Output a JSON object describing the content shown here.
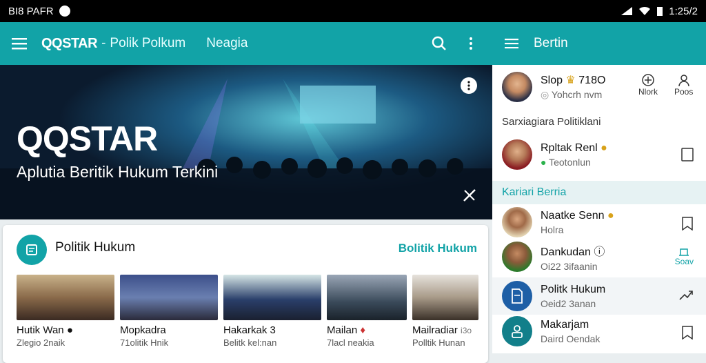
{
  "status": {
    "left": "BI8 PAFR",
    "time": "1:25/2",
    "icons": [
      "wifi-icon",
      "signal-icon",
      "battery-icon"
    ]
  },
  "appbar": {
    "title": "QQSTAR",
    "separator": "-",
    "subtitle": "Polik Polkum",
    "media": "Neagia"
  },
  "hero": {
    "heading": "QQSTAR",
    "tagline": "Aplutia Beritik Hukum Terkini"
  },
  "card": {
    "title": "Politik Hukum",
    "link": "Bolitik Hukum",
    "items": [
      {
        "title": "Hutik Wan",
        "sub": "Zlegio 2naik"
      },
      {
        "title": "Mopkadra",
        "sub": "71olitik Hnik"
      },
      {
        "title": "Hakarkak 3",
        "sub": "Belitk kel:nan"
      },
      {
        "title": "Mailan",
        "sub": "7lacl neakia"
      },
      {
        "title": "Mailradiar",
        "sub": "Polltik Hunan",
        "extra": "i3o"
      }
    ]
  },
  "panel": {
    "title": "Bertin",
    "profile": {
      "name": "Slop",
      "extra": "718O",
      "sub": "Yohcrh nvm",
      "action1": "Nlork",
      "action2": "Poos"
    },
    "section1": "Sarxiagiara Politiklani",
    "item1": {
      "name": "Rpltak Renl",
      "sub": "Teotonlun"
    },
    "section2": "Kariari Berria",
    "list": [
      {
        "name": "Naatke Senn",
        "sub": "Holra"
      },
      {
        "name": "Dankudan",
        "sub": "Oi22 3ifaanin",
        "action": "Soav"
      },
      {
        "name": "Politk Hukum",
        "sub": "Oeid2 3anan"
      },
      {
        "name": "Makarjam",
        "sub": "Daird Oendak"
      }
    ]
  },
  "colors": {
    "accent": "#12a3a7",
    "statusbar": "#000000"
  }
}
